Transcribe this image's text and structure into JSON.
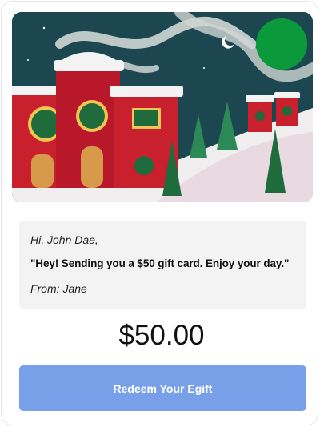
{
  "gift": {
    "greeting": "Hi, John Dae,",
    "message": "\"Hey! Sending you a $50 gift card. Enjoy your day.\"",
    "sender": "From: Jane",
    "amount": "$50.00",
    "redeem_label": "Redeem Your Egift"
  },
  "colors": {
    "button": "#78a0e8",
    "badge": "#0b9a3b",
    "sky": "#1c4751"
  }
}
